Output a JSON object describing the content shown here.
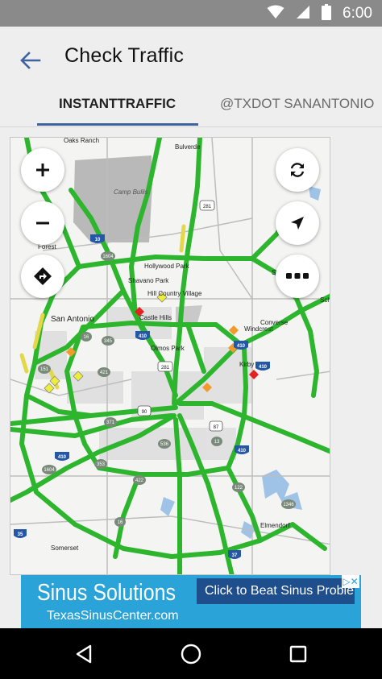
{
  "status_bar": {
    "time": "6:00"
  },
  "app_bar": {
    "title": "Check Traffic",
    "tabs": [
      {
        "label": "INSTANTTRAFFIC",
        "selected": true
      },
      {
        "label": "@TXDOT SANANTONIO",
        "selected": false
      }
    ]
  },
  "map": {
    "labels": {
      "oaks_ranch": "Oaks Ranch",
      "bulverde": "Bulverde",
      "camp_bullis": "Camp Bullis",
      "forest": "Forest",
      "hollywood_park": "Hollywood Park",
      "shavano_park": "Shavano Park",
      "hill_country_village": "Hill Country Village",
      "castle_hills": "Castle Hills",
      "san_antonio": "San Antonio",
      "olmos_park": "Olmos Park",
      "converse": "Converse",
      "windcrest": "Windcrest",
      "kirby": "Kirby",
      "elmendorf": "Elmendorf",
      "somerset": "Somerset",
      "se_edge": "Se",
      "sch_edge": "Sch"
    },
    "shields": {
      "i10_north": "10",
      "i410_mid": "410",
      "i410_east": "410",
      "i410_west": "410",
      "i410_south": "410",
      "i35_south": "35",
      "i37": "37",
      "us281_north": "281",
      "us281_mid": "281",
      "us90": "90",
      "us87": "87",
      "loop1604": "1604",
      "loop1604_sw": "1604",
      "tx16": "16",
      "tx13": "13",
      "tx345": "345",
      "tx421": "421",
      "tx151": "151",
      "tx371": "371",
      "tx536": "536",
      "tx353": "353",
      "tx422": "422",
      "tx122": "122",
      "tx1346": "1346"
    },
    "buttons": {
      "zoom_in": "plus-icon",
      "zoom_out": "minus-icon",
      "directions": "directions-icon",
      "refresh": "refresh-icon",
      "locate": "navigation-arrow-icon",
      "more": "more-horiz-icon"
    },
    "colors": {
      "road_clear": "#2db52d",
      "road_slow": "#e3d84a",
      "incident_major": "#e52222",
      "incident_minor": "#f39a2b",
      "incident_caution": "#eded3a"
    }
  },
  "ad": {
    "headline": "Sinus Solutions",
    "url": "TexasSinusCenter.com",
    "cta": "Click to Beat Sinus Problems",
    "adchoices": "▷✕"
  },
  "colors": {
    "accent": "#3f63a0",
    "status_bar": "#8a8a8a",
    "ad_background": "#2aa3d8",
    "ad_cta": "#1f4e8c"
  }
}
